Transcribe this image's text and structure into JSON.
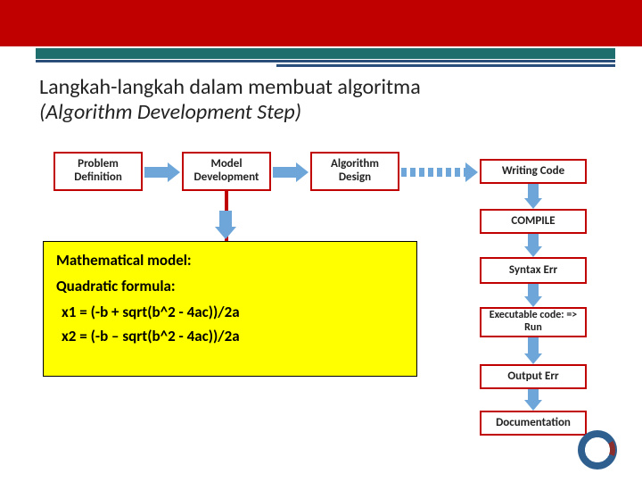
{
  "header": {
    "title_line1": "Langkah-langkah dalam membuat algoritma",
    "title_line2": "(Algorithm Development Step)"
  },
  "flow": {
    "steps_top": [
      "Problem Definition",
      "Model Development",
      "Algorithm Design",
      "Writing Code"
    ],
    "right_column": [
      "COMPILE",
      "Syntax Err",
      "Executable code: => Run",
      "Output Err",
      "Documentation"
    ]
  },
  "callout": {
    "heading1": "Mathematical model:",
    "heading2": "Quadratic formula:",
    "eq1": "x1 = (-b + sqrt(b^2 - 4ac))/2a",
    "eq2": "x2 = (-b – sqrt(b^2 - 4ac))/2a"
  },
  "colors": {
    "red": "#C00000",
    "arrow": "#6EA6D9",
    "yellow": "#FFFF00",
    "teal": "#1F6E6E",
    "navy": "#294E7A"
  }
}
